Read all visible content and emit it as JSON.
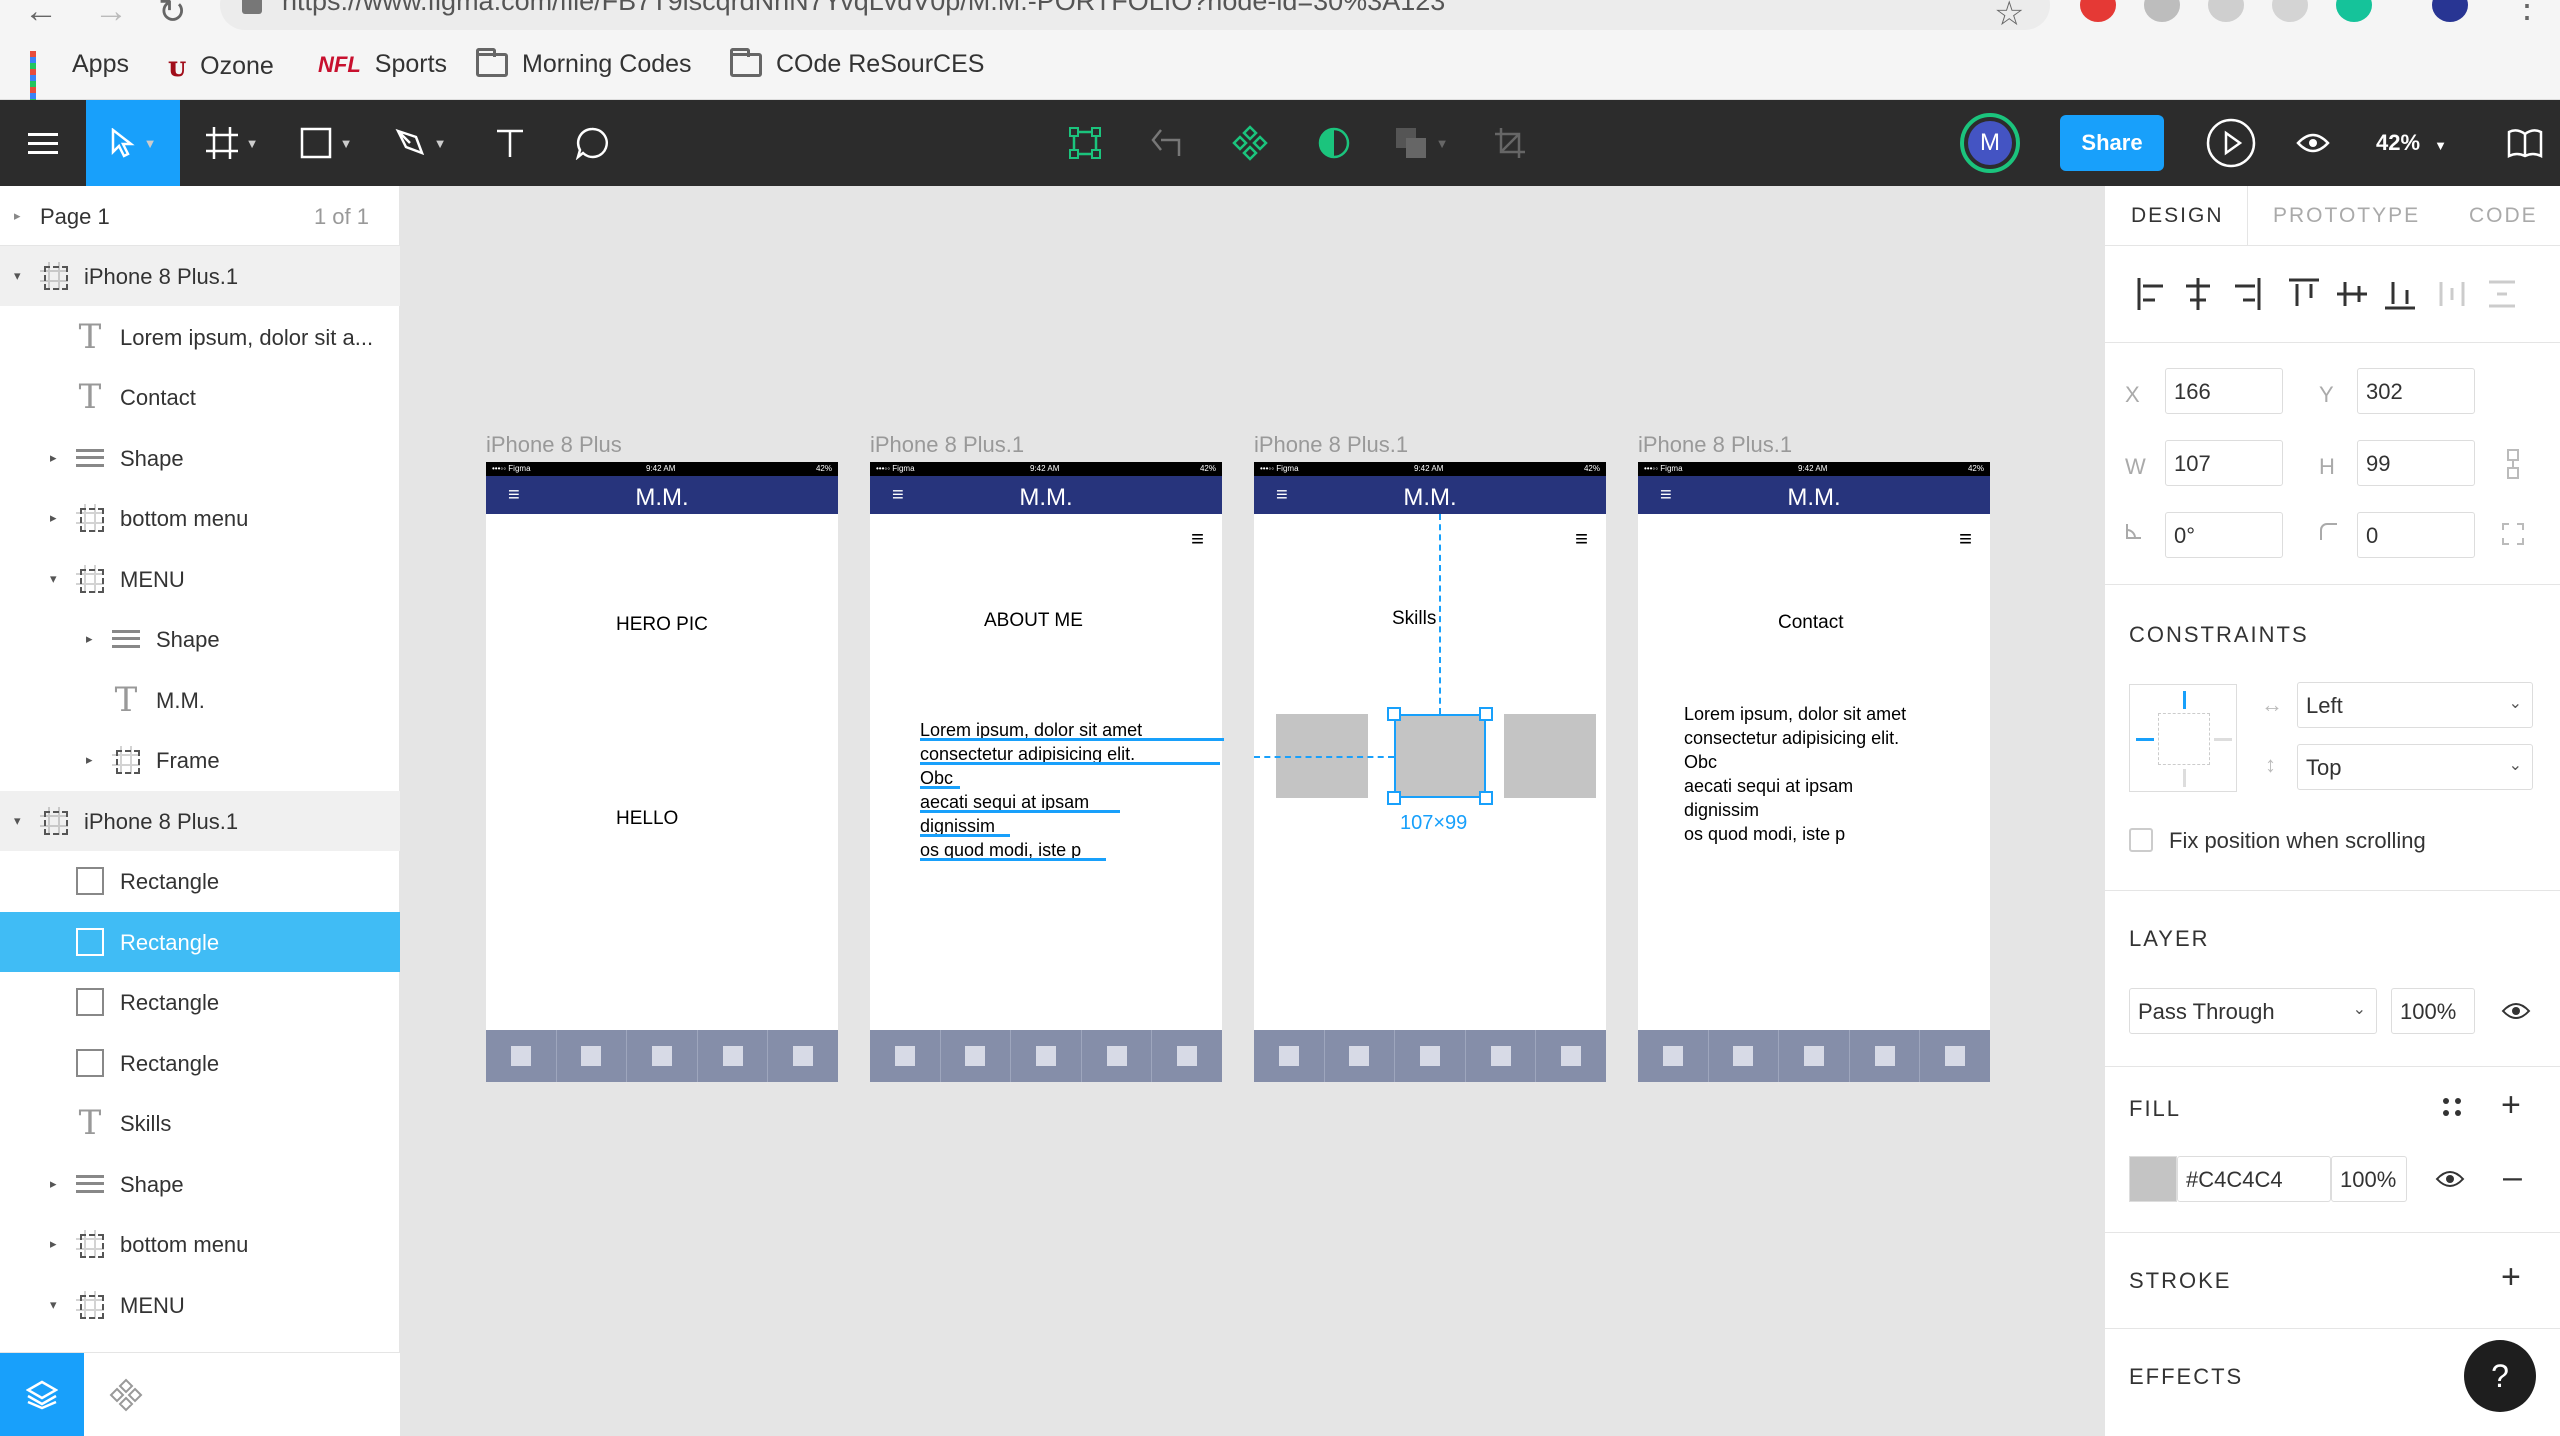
{
  "browser": {
    "url": "https://www.figma.com/file/FB7T9lscqrdNhN7YvqLvdV0p/M.M.-PORTFOLIO?node-id=30%3A123",
    "bookmarks": [
      {
        "label": "Apps",
        "icon": "apps-grid-icon"
      },
      {
        "label": "Ozone",
        "icon": "ozone-logo-icon"
      },
      {
        "label": "Sports",
        "icon": "nfl-logo-icon"
      },
      {
        "label": "Morning Codes",
        "icon": "folder-icon"
      },
      {
        "label": "COde ReSourCES",
        "icon": "folder-icon"
      }
    ],
    "extensions": [
      {
        "icon": "adblock-icon",
        "color": "#e53935"
      },
      {
        "icon": "cloud-icon",
        "color": "#bdbdbd"
      },
      {
        "icon": "translate-icon",
        "color": "#cfcfcf"
      },
      {
        "icon": "screen-icon",
        "color": "#d4d4d4"
      },
      {
        "icon": "grammarly-icon",
        "color": "#15c39a"
      },
      {
        "icon": "profile-icon",
        "color": "#283593"
      }
    ]
  },
  "toolbar": {
    "tools": [
      "menu-icon",
      "move-tool-icon",
      "frame-tool-icon",
      "rectangle-tool-icon",
      "pen-tool-icon",
      "text-tool-icon",
      "comment-tool-icon"
    ],
    "center_tools": [
      "edit-object-icon",
      "create-component-icon",
      "component-icon",
      "mask-icon",
      "boolean-icon",
      "crop-icon"
    ],
    "avatar_initial": "M",
    "share_label": "Share",
    "zoom": "42%"
  },
  "layers": {
    "page_name": "Page 1",
    "page_count": "1 of 1",
    "items": [
      {
        "label": "iPhone 8 Plus.1",
        "icon": "frame",
        "indent": 0,
        "arrow": "down",
        "section": true
      },
      {
        "label": "Lorem ipsum, dolor sit a...",
        "icon": "text",
        "indent": 1,
        "arrow": ""
      },
      {
        "label": "Contact",
        "icon": "text",
        "indent": 1,
        "arrow": ""
      },
      {
        "label": "Shape",
        "icon": "shape",
        "indent": 1,
        "arrow": "right"
      },
      {
        "label": "bottom menu",
        "icon": "frame",
        "indent": 1,
        "arrow": "right"
      },
      {
        "label": "MENU",
        "icon": "frame",
        "indent": 1,
        "arrow": "down"
      },
      {
        "label": "Shape",
        "icon": "shape",
        "indent": 2,
        "arrow": "right"
      },
      {
        "label": "M.M.",
        "icon": "text",
        "indent": 2,
        "arrow": ""
      },
      {
        "label": "Frame",
        "icon": "frame",
        "indent": 2,
        "arrow": "right"
      },
      {
        "label": "iPhone 8 Plus.1",
        "icon": "frame",
        "indent": 0,
        "arrow": "down",
        "section": true
      },
      {
        "label": "Rectangle",
        "icon": "rect",
        "indent": 1,
        "arrow": ""
      },
      {
        "label": "Rectangle",
        "icon": "rect",
        "indent": 1,
        "arrow": "",
        "selected": true
      },
      {
        "label": "Rectangle",
        "icon": "rect",
        "indent": 1,
        "arrow": ""
      },
      {
        "label": "Rectangle",
        "icon": "rect",
        "indent": 1,
        "arrow": ""
      },
      {
        "label": "Skills",
        "icon": "text",
        "indent": 1,
        "arrow": ""
      },
      {
        "label": "Shape",
        "icon": "shape",
        "indent": 1,
        "arrow": "right"
      },
      {
        "label": "bottom menu",
        "icon": "frame",
        "indent": 1,
        "arrow": "right"
      },
      {
        "label": "MENU",
        "icon": "frame",
        "indent": 1,
        "arrow": "down"
      }
    ]
  },
  "canvas": {
    "frames": [
      {
        "label": "iPhone 8 Plus",
        "status_left": "•••◦◦ Figma",
        "status_center": "9:42 AM",
        "status_right": "42%",
        "header_title": "M.M.",
        "texts": [
          "HERO PIC",
          "HELLO"
        ]
      },
      {
        "label": "iPhone 8 Plus.1",
        "status_left": "•••◦◦ Figma",
        "status_center": "9:42 AM",
        "status_right": "42%",
        "header_title": "M.M.",
        "heading": "ABOUT ME",
        "paragraph": [
          "Lorem ipsum, dolor sit amet",
          "consectetur adipisicing elit.",
          "Obc",
          "aecati sequi at ipsam",
          "dignissim",
          "os quod modi, iste p"
        ]
      },
      {
        "label": "iPhone 8 Plus.1",
        "status_left": "•••◦◦ Figma",
        "status_center": "9:42 AM",
        "status_right": "42%",
        "header_title": "M.M.",
        "heading": "Skills",
        "dimension": "107×99"
      },
      {
        "label": "iPhone 8 Plus.1",
        "status_left": "•••◦◦ Figma",
        "status_center": "9:42 AM",
        "status_right": "42%",
        "header_title": "M.M.",
        "heading": "Contact",
        "paragraph": [
          "Lorem ipsum, dolor sit amet",
          "consectetur adipisicing elit.",
          "Obc",
          "aecati sequi at ipsam",
          "dignissim",
          "os quod modi, iste p"
        ]
      }
    ],
    "colors": {
      "header": "#27347c",
      "bottom_bar": "#858ea9",
      "selection": "#18a0fb",
      "rect_fill": "#c4c4c4"
    }
  },
  "properties": {
    "tabs": [
      "DESIGN",
      "PROTOTYPE",
      "CODE"
    ],
    "x_label": "X",
    "x": "166",
    "y_label": "Y",
    "y": "302",
    "w_label": "W",
    "w": "107",
    "h_label": "H",
    "h": "99",
    "rotation": "0°",
    "radius": "0",
    "constraints_title": "CONSTRAINTS",
    "horizontal_constraint": "Left",
    "vertical_constraint": "Top",
    "fix_position_label": "Fix position when scrolling",
    "layer_title": "LAYER",
    "blend_mode": "Pass Through",
    "layer_opacity": "100%",
    "fill_title": "FILL",
    "fill_hex": "#C4C4C4",
    "fill_opacity": "100%",
    "stroke_title": "STROKE",
    "effects_title": "EFFECTS",
    "help_label": "?"
  }
}
